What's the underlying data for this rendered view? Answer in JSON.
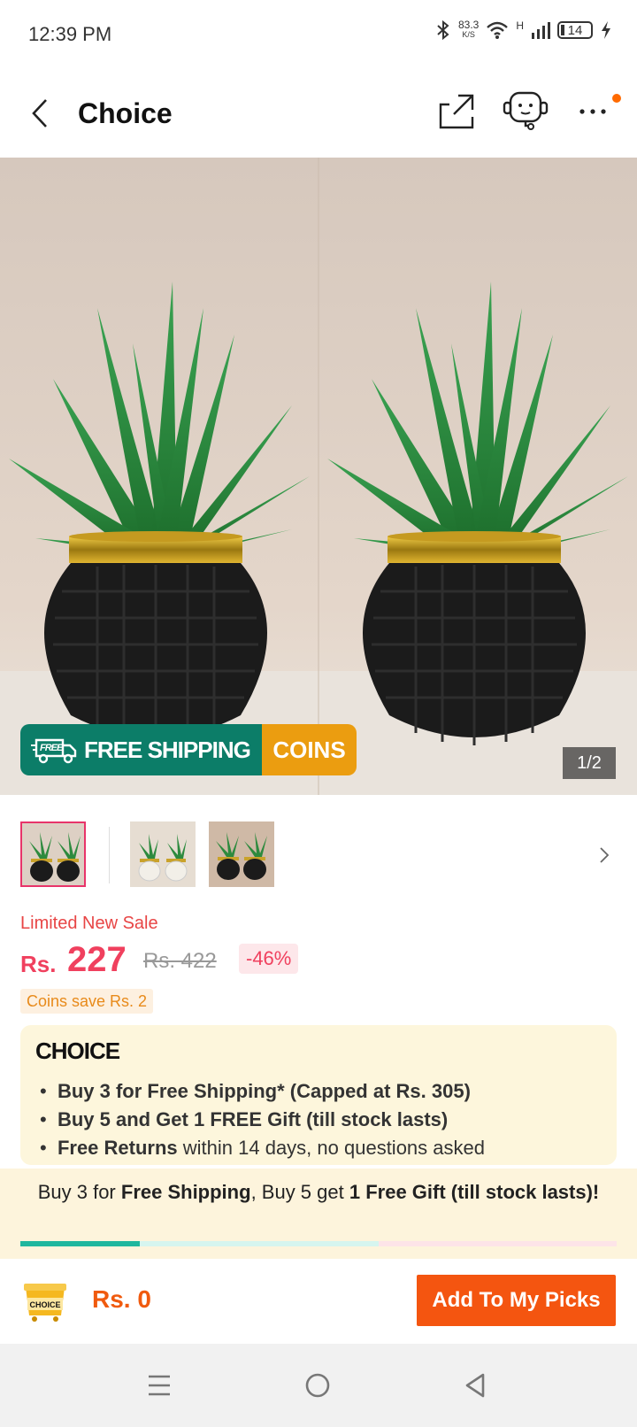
{
  "status_bar": {
    "time": "12:39 PM",
    "net_speed": "83.3",
    "net_unit": "K/S",
    "network_type": "H",
    "battery": "14"
  },
  "header": {
    "back_icon": "chevron-left-icon",
    "title": "Choice",
    "share_icon": "share-icon",
    "support_icon": "customer-service-icon",
    "more_icon": "more-icon"
  },
  "gallery": {
    "badge_free_label": "FREE",
    "badge_shipping": "FREE SHIPPING",
    "badge_coins": "COINS",
    "counter": "1/2",
    "next_icon": "chevron-right-icon"
  },
  "product": {
    "sale_label": "Limited New Sale",
    "currency": "Rs.",
    "price": "227",
    "old_price": "Rs. 422",
    "discount": "-46%",
    "coins_save": "Coins save Rs. 2"
  },
  "choice": {
    "logo": "CHOICE",
    "bullets": [
      {
        "bold": "Buy 3 for  Free Shipping* (Capped at Rs. 305)",
        "rest": ""
      },
      {
        "bold": "Buy 5 and Get 1 FREE Gift (till stock lasts)",
        "rest": ""
      },
      {
        "bold": "Free Returns",
        "rest": " within 14 days, no questions asked"
      }
    ]
  },
  "banner": {
    "t1": "Buy 3 for ",
    "t2": "Free Shipping",
    "t3": ", Buy 5 get ",
    "t4": "1 Free Gift (till stock lasts)!",
    "progress": 0.2
  },
  "bottom_bar": {
    "cart_icon_label": "CHOICE",
    "total": "Rs. 0",
    "add_button": "Add To My Picks"
  },
  "colors": {
    "accent": "#f45510",
    "price": "#f0405e",
    "free_shipping": "#0c7d68",
    "coins": "#eb9d10"
  }
}
